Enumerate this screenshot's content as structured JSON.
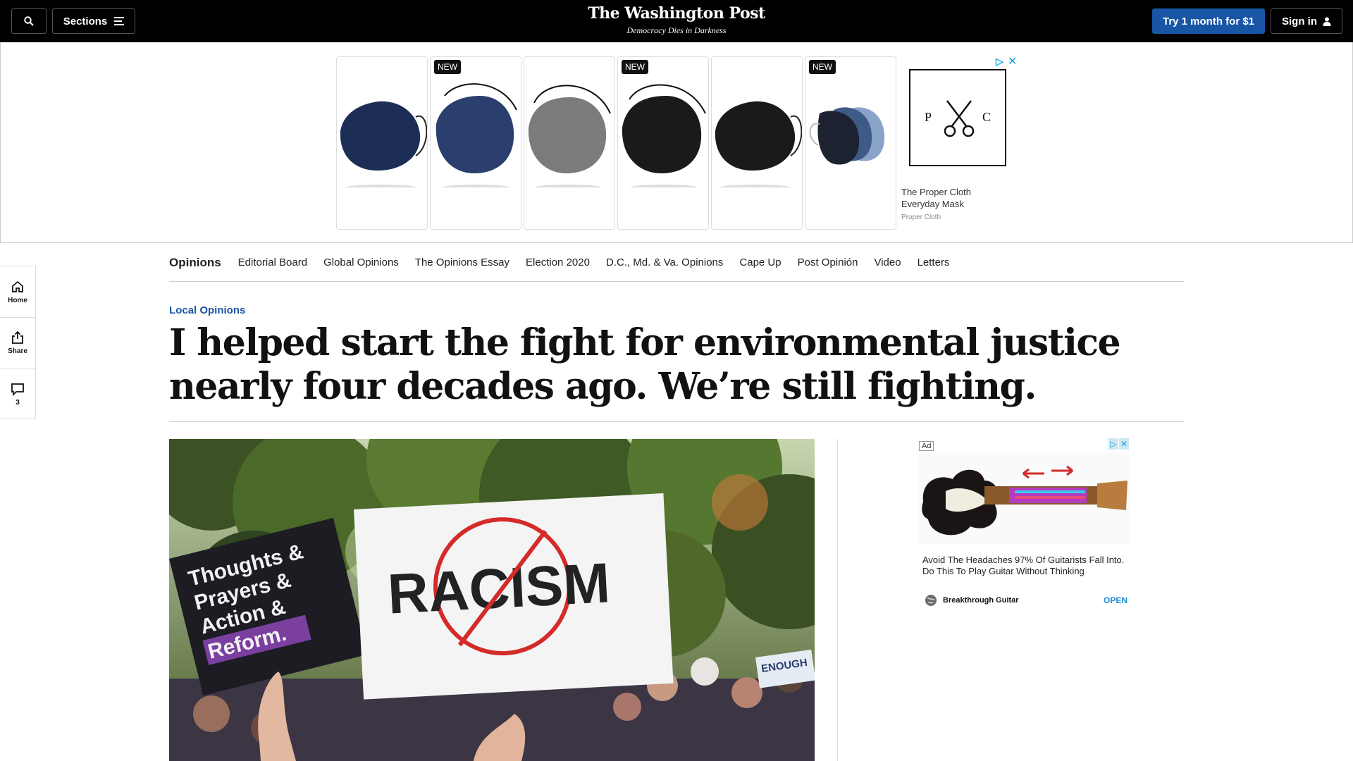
{
  "header": {
    "sections_label": "Sections",
    "logo": "The Washington Post",
    "tagline": "Democracy Dies in Darkness",
    "trial_label": "Try 1 month for $1",
    "signin_label": "Sign in",
    "background": "#000000",
    "trial_color": "#1955a5"
  },
  "top_ad": {
    "badges": [
      "NEW",
      "NEW",
      "NEW"
    ],
    "logo_letters": [
      "P",
      "C"
    ],
    "title": "The Proper Cloth Everyday Mask",
    "sponsor": "Proper Cloth",
    "products": [
      {
        "color": "navy-mask"
      },
      {
        "color": "navy-mask"
      },
      {
        "color": "gray-mask"
      },
      {
        "color": "black-mask"
      },
      {
        "color": "black-mask"
      },
      {
        "color": "three-pack-mask"
      }
    ]
  },
  "rail": {
    "home_label": "Home",
    "share_label": "Share",
    "comments_count": "3"
  },
  "subnav": {
    "items": [
      "Opinions",
      "Editorial Board",
      "Global Opinions",
      "The Opinions Essay",
      "Election 2020",
      "D.C., Md. & Va. Opinions",
      "Cape Up",
      "Post Opinión",
      "Video",
      "Letters"
    ]
  },
  "article": {
    "kicker": "Local Opinions",
    "headline": "I helped start the fight for environmental justice nearly four decades ago. We’re still fighting.",
    "image": {
      "sign_main": "RACISM",
      "sign_left": [
        "Thoughts &",
        "Prayers &",
        "Action &",
        "Reform."
      ],
      "sign_right": "ENOUGH"
    }
  },
  "right_ad": {
    "ad_label": "Ad",
    "text": "Avoid The Headaches 97% Of Guitarists Fall Into. Do This To Play Guitar Without Thinking",
    "brand": "Breakthrough Guitar",
    "cta": "OPEN"
  }
}
